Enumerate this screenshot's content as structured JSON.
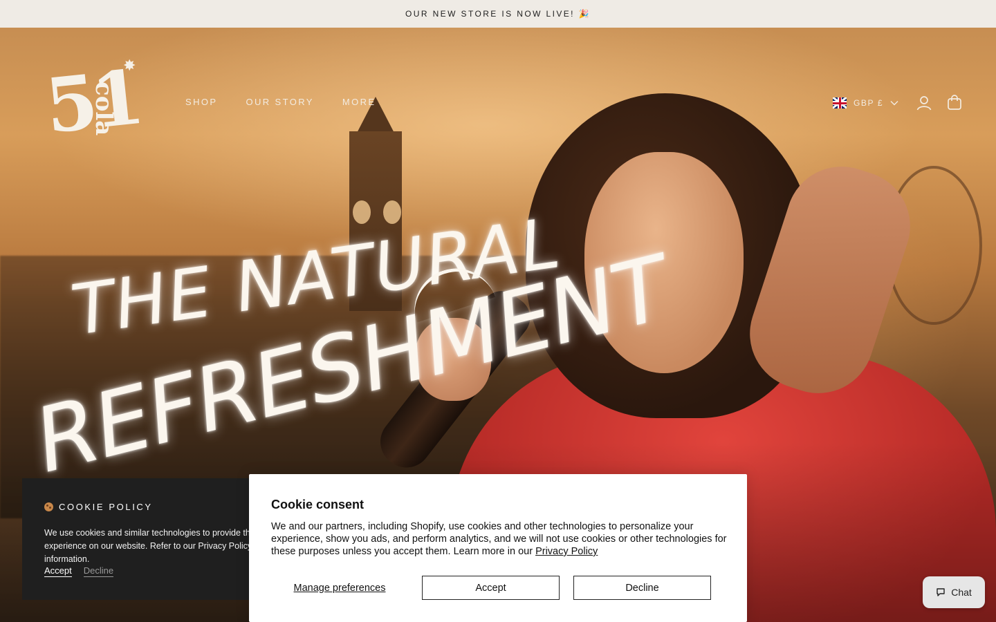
{
  "announcement": {
    "text": "OUR NEW STORE IS NOW LIVE! 🎉"
  },
  "brand": {
    "number": "51",
    "word": "cola",
    "star": "✸"
  },
  "nav": {
    "items": [
      {
        "label": "SHOP"
      },
      {
        "label": "OUR STORY"
      },
      {
        "label": "MORE"
      }
    ]
  },
  "header_right": {
    "currency": "GBP £",
    "flag": "uk-flag-icon",
    "account_icon": "account-icon",
    "cart_icon": "shopping-bag-icon"
  },
  "hero": {
    "headline_line1": "The Natural",
    "headline_line2": "Refreshment"
  },
  "cookie_policy": {
    "title": "COOKIE POLICY",
    "text": "We use cookies and similar technologies to provide the best experience on our website. Refer to our Privacy Policy for more information.",
    "accept_label": "Accept",
    "decline_label": "Decline"
  },
  "cookie_consent": {
    "title": "Cookie consent",
    "body": "We and our partners, including Shopify, use cookies and other technologies to personalize your experience, show you ads, and perform analytics, and we will not use cookies or other technologies for these purposes unless you accept them. Learn more in our ",
    "privacy_link": "Privacy Policy",
    "manage_label": "Manage preferences",
    "accept_label": "Accept",
    "decline_label": "Decline"
  },
  "chat": {
    "label": "Chat"
  },
  "colors": {
    "announce_bg": "#efebe5",
    "panel_bg": "#1f1f1f",
    "sweater": "#d63a34"
  }
}
